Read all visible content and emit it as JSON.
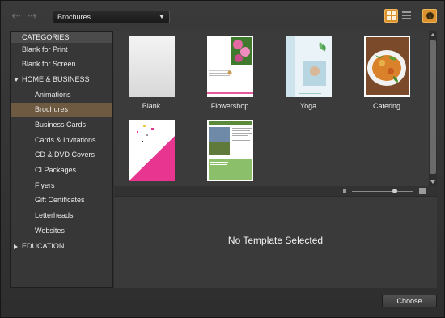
{
  "toolbar": {
    "category_select": "Brochures"
  },
  "sidebar": {
    "header": "CATEGORIES",
    "items": [
      {
        "label": "Blank for Print"
      },
      {
        "label": "Blank for Screen"
      },
      {
        "label": "HOME & BUSINESS"
      },
      {
        "label": "Animations"
      },
      {
        "label": "Brochures"
      },
      {
        "label": "Business Cards"
      },
      {
        "label": "Cards & Invitations"
      },
      {
        "label": "CD & DVD Covers"
      },
      {
        "label": "CI Packages"
      },
      {
        "label": "Flyers"
      },
      {
        "label": "Gift Certificates"
      },
      {
        "label": "Letterheads"
      },
      {
        "label": "Websites"
      },
      {
        "label": "EDUCATION"
      }
    ],
    "selected": "Brochures"
  },
  "templates": [
    {
      "label": "Blank"
    },
    {
      "label": "Flowershop"
    },
    {
      "label": "Yoga"
    },
    {
      "label": "Catering"
    },
    {
      "label": ""
    },
    {
      "label": ""
    }
  ],
  "detail": {
    "message": "No Template Selected"
  },
  "footer": {
    "choose_label": "Choose"
  },
  "colors": {
    "accent": "#d9922e",
    "selection": "#6e5a41",
    "panel": "#3b3b3b"
  },
  "zoom": {
    "level": 0.7
  }
}
